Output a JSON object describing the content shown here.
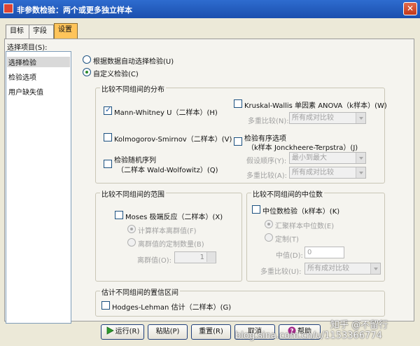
{
  "window": {
    "title": "非参数检验：两个或更多独立样本",
    "close_symbol": "✕"
  },
  "tabs": [
    "目标",
    "字段",
    "设置"
  ],
  "active_tab_index": 2,
  "left_panel": {
    "header": "选择项目(S):",
    "items": [
      "选择检验",
      "检验选项",
      "用户缺失值"
    ],
    "selected_index": 0
  },
  "mode_options": {
    "auto_label": "根据数据自动选择检验(U)",
    "custom_label": "自定义检验(C)",
    "selected": "custom"
  },
  "compare_distributions": {
    "title": "比较不同组间的分布",
    "mann_whitney": {
      "label": "Mann-Whitney U（二样本）(H)",
      "checked": true
    },
    "kolmogorov": {
      "label": "Kolmogorov-Smirnov（二样本）(V)",
      "checked": false
    },
    "runs": {
      "label_line1": "检验随机序列",
      "label_line2": "（二样本 Wald-Wolfowitz）(Q)",
      "checked": false
    },
    "kruskal": {
      "label": "Kruskal-Wallis 单因素 ANOVA（k样本）(W)",
      "checked": false
    },
    "multiple_compare_label": "多重比较(N):",
    "multiple_compare_value": "所有成对比较",
    "ordered": {
      "label_line1": "检验有序选项",
      "label_line2": "（k样本 Jonckheere-Terpstra）(J)",
      "checked": false
    },
    "hypothesis_order_label": "假设顺序(Y):",
    "hypothesis_order_value": "最小到最大",
    "multiple_compare2_label": "多重比较(A):",
    "multiple_compare2_value": "所有成对比较"
  },
  "compare_ranges": {
    "title": "比较不同组间的范围",
    "moses": {
      "label": "Moses 极端反应（二样本）(X)",
      "checked": false
    },
    "compute_outliers_label": "计算样本离群值(F)",
    "custom_outliers_label": "离群值的定制数量(B)",
    "outliers_label": "离群值(O):",
    "outliers_value": "1"
  },
  "compare_medians": {
    "title": "比较不同组间的中位数",
    "median_test": {
      "label": "中位数检验（k样本）(K)",
      "checked": false
    },
    "pooled_median_label": "汇聚样本中位数(E)",
    "custom_label": "定制(T)",
    "median_value_label": "中值(D):",
    "median_value": "0",
    "multiple_compare_label": "多重比较(U):",
    "multiple_compare_value": "所有成对比较"
  },
  "confidence_interval": {
    "title": "估计不同组间的置信区间",
    "hodges": {
      "label": "Hodges-Lehman 估计（二样本）(G)",
      "checked": false
    }
  },
  "buttons": {
    "run": "运行(R)",
    "paste": "粘贴(P)",
    "reset": "重置(R)",
    "cancel": "取消",
    "help": "帮助"
  },
  "watermark": {
    "line1": "知乎 @不留行",
    "line2": "blog.sina.com.cn/u/1153366774"
  }
}
